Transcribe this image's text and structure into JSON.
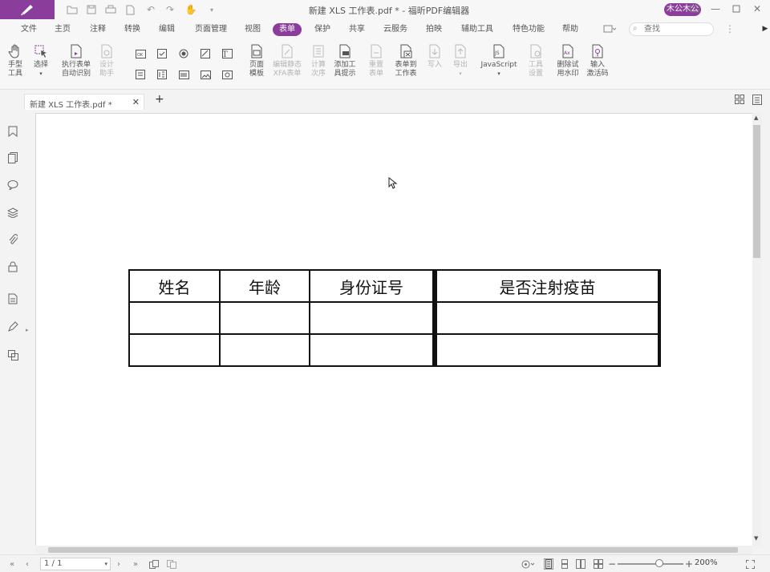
{
  "title_bar": {
    "title": "新建 XLS 工作表.pdf * - 福昕PDF编辑器",
    "user_badge": "木公木公"
  },
  "menu": {
    "items": [
      "文件",
      "主页",
      "注释",
      "转换",
      "编辑",
      "页面管理",
      "视图",
      "表单",
      "保护",
      "共享",
      "云服务",
      "拍映",
      "辅助工具",
      "特色功能",
      "帮助"
    ],
    "active": "表单",
    "search_placeholder": "查找"
  },
  "ribbon": {
    "hand_tool": "手型\n工具",
    "select": "选择",
    "run_form_recognition": "执行表单\n自动识别",
    "design_assistant": "设计\n助手",
    "page_template": "页面\n模板",
    "edit_xfa": "编辑静态\nXFA表单",
    "calc_order": "计算\n次序",
    "add_tooltip": "添加工\n具提示",
    "reset_form": "重置\n表单",
    "form_to_sheet": "表单到\n工作表",
    "import": "写入",
    "export": "导出",
    "javascript": "JavaScript",
    "tool_settings": "工具\n设置",
    "remove_watermark": "删除试\n用水印",
    "enter_activation": "输入\n激活码"
  },
  "tab": {
    "name": "新建 XLS 工作表.pdf *"
  },
  "document": {
    "table_headers": [
      "姓名",
      "年龄",
      "身份证号",
      "是否注射疫苗"
    ],
    "empty_rows": 2
  },
  "status": {
    "page_indicator": "1 / 1",
    "zoom": "200%"
  },
  "colors": {
    "accent": "#8a3d9a",
    "table_border": "#111111"
  }
}
